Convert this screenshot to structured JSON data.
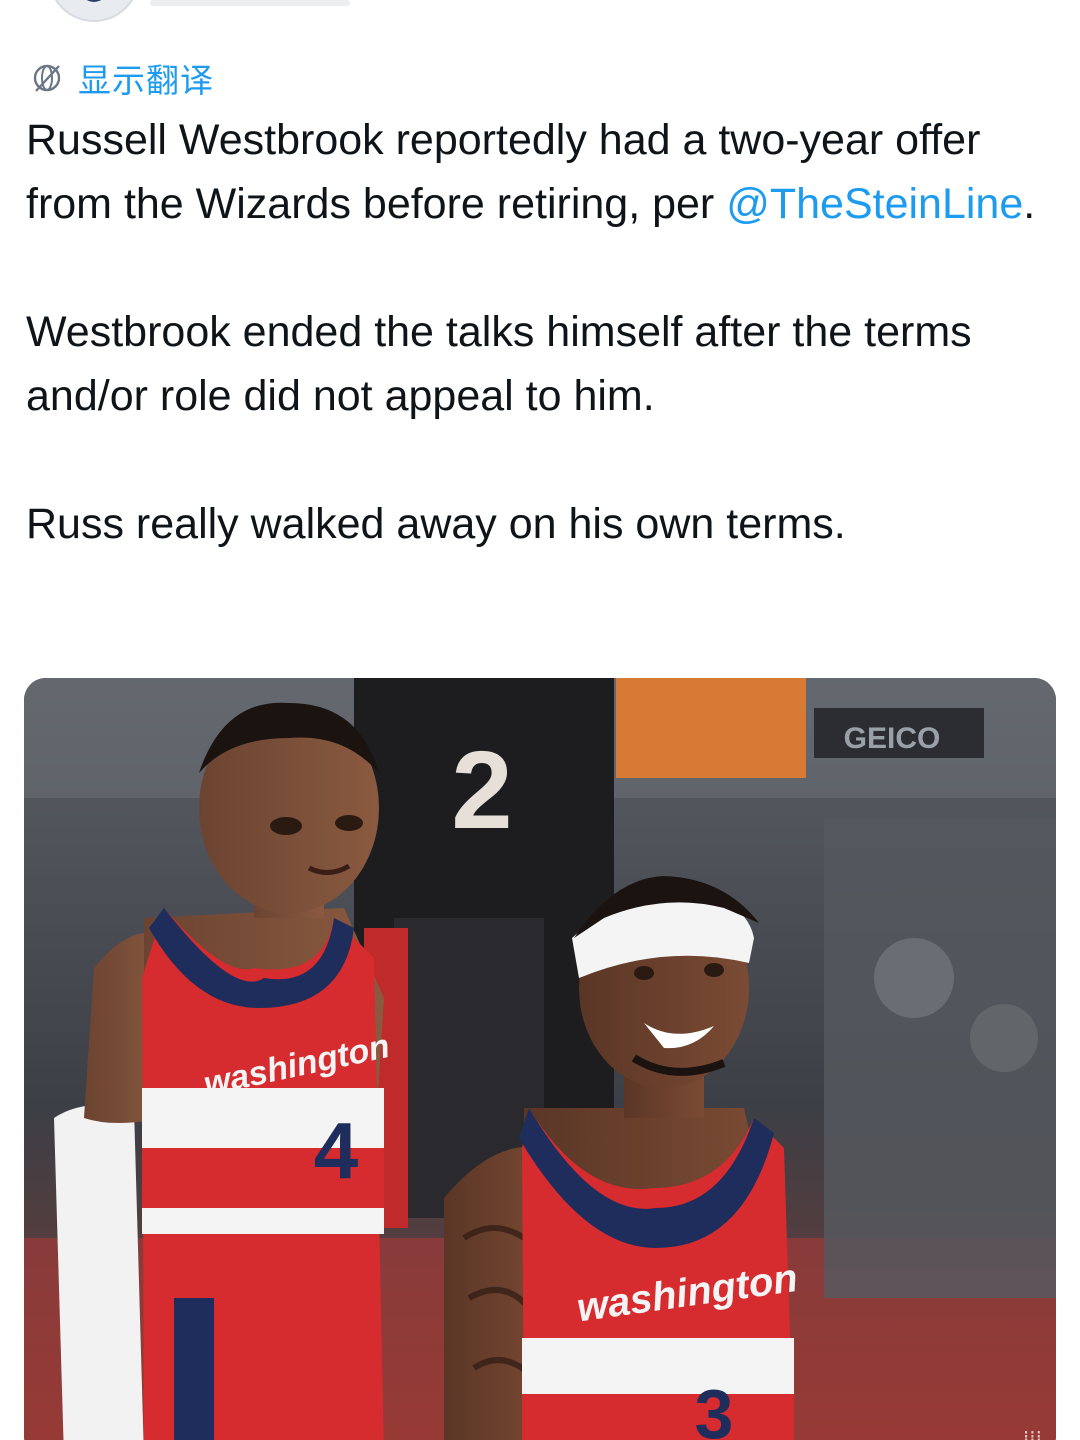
{
  "translate": {
    "icon": "translate-globe-icon",
    "label": "显示翻译"
  },
  "tweet": {
    "paragraph1_prefix": "Russell Westbrook reportedly had a two-year offer from the Wizards before retiring, per ",
    "mention": "@TheSteinLine",
    "paragraph1_suffix": ".",
    "paragraph2": "Westbrook ended the talks himself after the terms and/or role did not appeal to him.",
    "paragraph3": "Russ really walked away on his own terms."
  },
  "colors": {
    "link": "#1d9bf0",
    "text": "#0f1419",
    "jersey_red": "#d62b2f",
    "jersey_navy": "#1f2d5c"
  },
  "photo": {
    "jersey_text_left": "washington",
    "jersey_number_left": "4",
    "jersey_text_right": "washington",
    "jersey_number_right": "3",
    "sponsor": "GEICO",
    "background_number": "2"
  }
}
